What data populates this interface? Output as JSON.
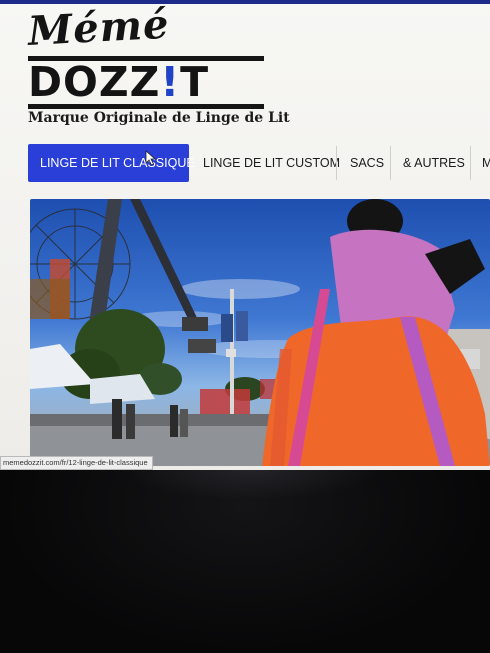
{
  "brand": {
    "script_name": "Mémé",
    "name_part1": "DOZZ",
    "name_bang": "!",
    "name_part2": "T",
    "tagline": "Marque Originale de Linge de Lit"
  },
  "nav": {
    "items": [
      {
        "label": "LINGE DE LIT CLASSIQUE",
        "active": true
      },
      {
        "label": "LINGE DE LIT CUSTOM",
        "active": false
      },
      {
        "label": "SACS",
        "active": false
      },
      {
        "label": "& AUTRES",
        "active": false
      },
      {
        "label": "M",
        "active": false
      }
    ]
  },
  "hero": {
    "slide_index": 1
  },
  "status_bar": {
    "link_url": "memedozzit.com/fr/12-linge-de-lit-classique"
  },
  "colors": {
    "accent": "#2a3fd8",
    "brand_blue": "#2143c8",
    "text": "#141414"
  },
  "icons": [
    "mouse-pointer-icon"
  ]
}
